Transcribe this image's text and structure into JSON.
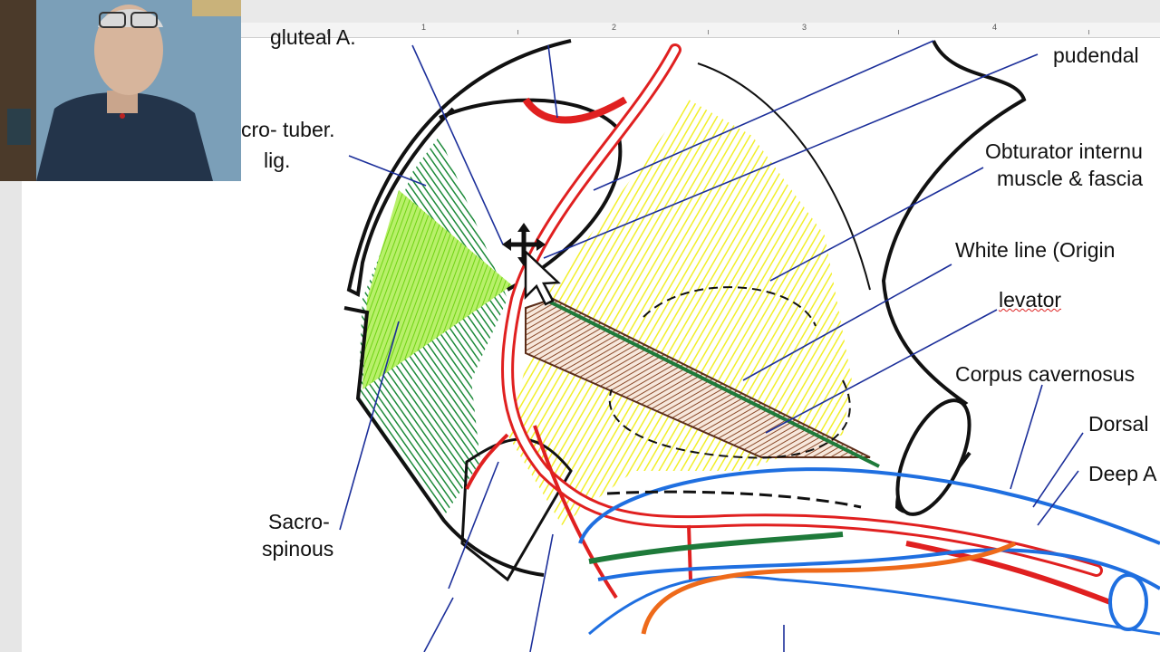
{
  "ruler": {
    "marks": [
      "1",
      "2",
      "3",
      "4"
    ]
  },
  "labels": {
    "gluteal": "gluteal A.",
    "pudendal": "pudendal",
    "sacrotuber_1": "cro- tuber.",
    "sacrotuber_2": "lig.",
    "obturator_1": "Obturator internu",
    "obturator_2": "muscle & fascia",
    "white_line": "White   line   (Origin",
    "levator": "levator",
    "corpus": "Corpus cavernosus",
    "dorsal": "Dorsal",
    "deep": "Deep A",
    "sacrospinous_1": "Sacro-",
    "sacrospinous_2": "spinous"
  },
  "colors": {
    "artery": "#e02020",
    "vein": "#1f6fe0",
    "muscle_yellow": "#f2ef2a",
    "ligament_green": "#1e8a3a",
    "light_green": "#7be51a",
    "levator_brown": "#8a4a2a",
    "pointer_blue": "#1c2f9a",
    "orange": "#ee6a1a"
  },
  "icons": {
    "cursor": "move-cursor-icon"
  }
}
